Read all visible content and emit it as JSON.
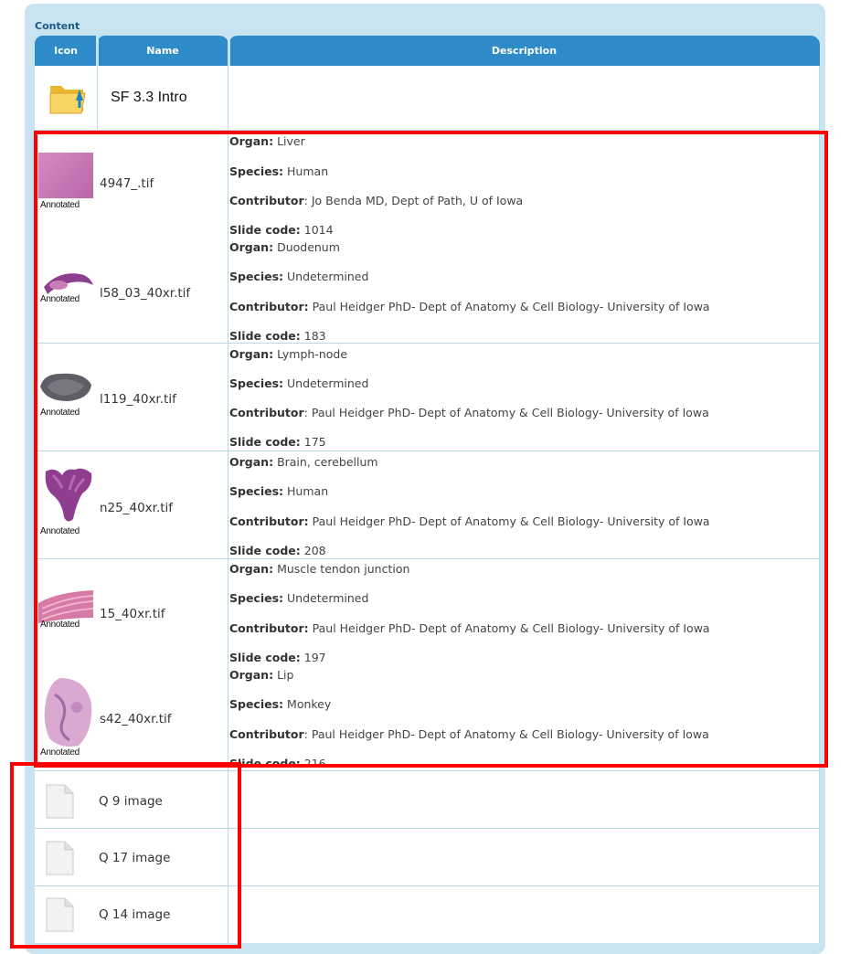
{
  "content_label": "Content",
  "columns": {
    "icon": "Icon",
    "name": "Name",
    "description": "Description"
  },
  "folder": {
    "name": "SF 3.3 Intro",
    "icon": "folder-up-icon"
  },
  "field_labels": {
    "organ": "Organ:",
    "species": "Species:",
    "contributor": "Contributor",
    "colon": ":",
    "slide_code": "Slide code:"
  },
  "slides": [
    {
      "file": "4947_.tif",
      "badge": "Annotated",
      "organ": "Liver",
      "species": "Human",
      "contributor": "Jo Benda MD, Dept of Path, U of Iowa",
      "slide_code": "1014"
    },
    {
      "file": "l58_03_40xr.tif",
      "badge": "Annotated",
      "organ": "Duodenum",
      "species": "Undetermined",
      "contributor": "Paul Heidger PhD- Dept of Anatomy & Cell Biology- University of Iowa",
      "slide_code": "183"
    },
    {
      "file": "l119_40xr.tif",
      "badge": "Annotated",
      "organ": "Lymph-node",
      "species": "Undetermined",
      "contributor": "Paul Heidger PhD- Dept of Anatomy & Cell Biology- University of Iowa",
      "slide_code": "175"
    },
    {
      "file": "n25_40xr.tif",
      "badge": "Annotated",
      "organ": "Brain, cerebellum",
      "species": "Human",
      "contributor": "Paul Heidger PhD- Dept of Anatomy & Cell Biology- University of Iowa",
      "slide_code": "208"
    },
    {
      "file": "15_40xr.tif",
      "badge": "Annotated",
      "organ": "Muscle tendon junction",
      "species": "Undetermined",
      "contributor": "Paul Heidger PhD- Dept of Anatomy & Cell Biology- University of Iowa",
      "slide_code": "197"
    },
    {
      "file": "s42_40xr.tif",
      "badge": "Annotated",
      "organ": "Lip",
      "species": "Monkey",
      "contributor": "Paul Heidger PhD- Dept of Anatomy & Cell Biology- University of Iowa",
      "slide_code": "216"
    }
  ],
  "images": [
    {
      "name": "Q 9 image",
      "icon": "document-icon"
    },
    {
      "name": "Q 17 image",
      "icon": "document-icon"
    },
    {
      "name": "Q 14 image",
      "icon": "document-icon"
    }
  ],
  "colors": {
    "header": "#2d8bc7",
    "panel": "#c9e4f1",
    "highlight": "#ff0000",
    "thumb_pink": "#c97fb5",
    "thumb_purple": "#8e3d8f"
  }
}
